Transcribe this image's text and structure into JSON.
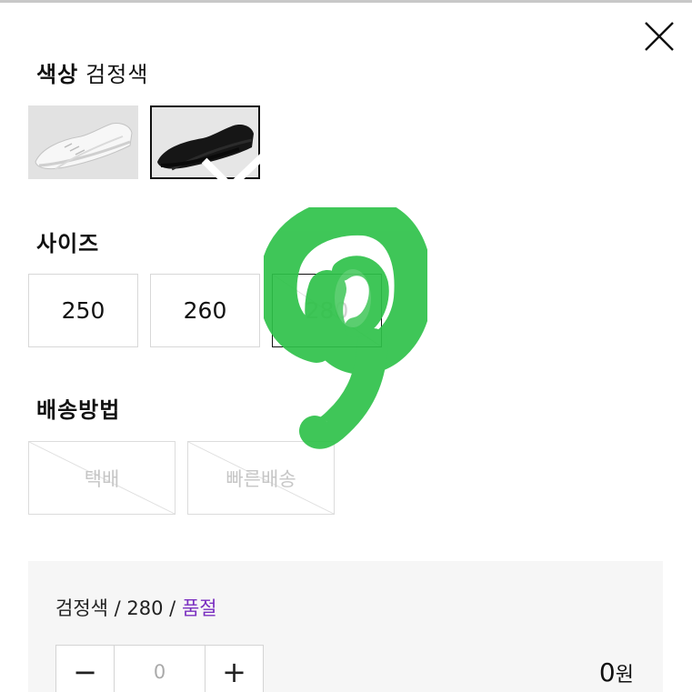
{
  "close": {
    "icon": "close-icon"
  },
  "color_section": {
    "label": "색상",
    "selected_value": "검정색",
    "options": [
      {
        "name": "white",
        "icon": "sneaker-white-image",
        "selected": false
      },
      {
        "name": "black",
        "icon": "sneaker-black-image",
        "selected": true
      }
    ]
  },
  "size_section": {
    "label": "사이즈",
    "options": [
      {
        "value": "250",
        "available": true
      },
      {
        "value": "260",
        "available": true
      },
      {
        "value": "280",
        "available": false,
        "selected": true
      }
    ]
  },
  "shipping_section": {
    "label": "배송방법",
    "options": [
      {
        "label": "택배",
        "available": false
      },
      {
        "label": "빠른배송",
        "available": false
      }
    ]
  },
  "summary": {
    "color": "검정색",
    "separator": " / ",
    "size": "280",
    "status": "품절",
    "quantity": "0",
    "minus": "−",
    "plus": "+",
    "price": "0",
    "price_unit": "원"
  },
  "colors": {
    "accent_soldout": "#7a2fc0",
    "scribble": "#2fc24a"
  }
}
